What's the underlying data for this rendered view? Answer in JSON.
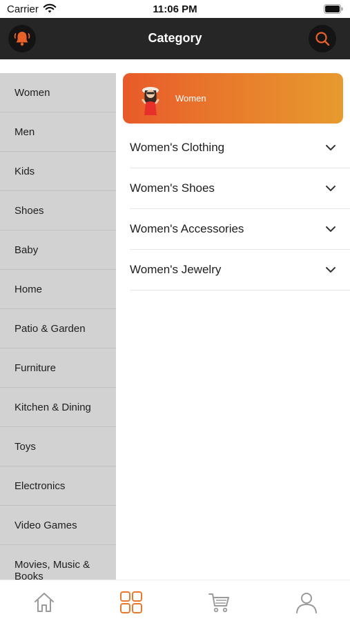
{
  "status": {
    "carrier": "Carrier",
    "time": "11:06 PM"
  },
  "header": {
    "title": "Category",
    "left_icon": "bell-icon",
    "right_icon": "search-icon"
  },
  "colors": {
    "header_bg": "#262626",
    "accent": "#e8792c",
    "sidebar_bg": "#d2d2d2"
  },
  "sidebar": {
    "items": [
      {
        "label": "Women"
      },
      {
        "label": "Men"
      },
      {
        "label": "Kids"
      },
      {
        "label": "Shoes"
      },
      {
        "label": "Baby"
      },
      {
        "label": "Home"
      },
      {
        "label": "Patio & Garden"
      },
      {
        "label": "Furniture"
      },
      {
        "label": "Kitchen & Dining"
      },
      {
        "label": "Toys"
      },
      {
        "label": "Electronics"
      },
      {
        "label": "Video Games"
      },
      {
        "label": "Movies, Music & Books"
      }
    ]
  },
  "banner": {
    "label": "Women"
  },
  "subcategories": [
    {
      "label": "Women's Clothing"
    },
    {
      "label": "Women's Shoes"
    },
    {
      "label": "Women's Accessories"
    },
    {
      "label": "Women's Jewelry"
    }
  ],
  "tabbar": {
    "tabs": [
      {
        "icon": "home-icon"
      },
      {
        "icon": "grid-icon",
        "active": true
      },
      {
        "icon": "cart-icon"
      },
      {
        "icon": "profile-icon"
      }
    ]
  }
}
